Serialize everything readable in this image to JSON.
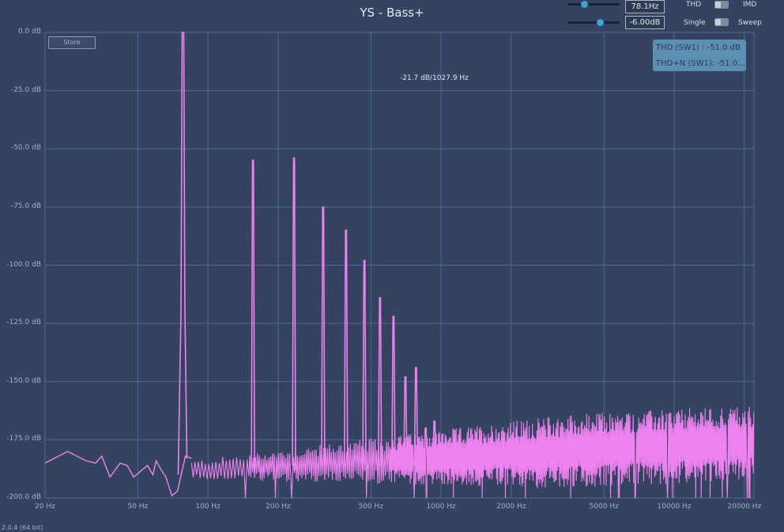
{
  "app": {
    "title": "YS - Bass+",
    "version": "2.0.4 (64 bit)",
    "store_label": "Store",
    "cursor_readout": "-21.7 dB/1027.9 Hz"
  },
  "controls": {
    "frequency": {
      "value": "78.1Hz",
      "level": 0.32
    },
    "amplitude": {
      "value": "-6.00dB",
      "level": 0.62
    },
    "mode_left": "THD",
    "mode_right": "IMD",
    "run_left": "Single",
    "run_right": "Sweep"
  },
  "thd_box": {
    "thd": "THD (SW1) : -51.0 dB",
    "thdn": "THD+N (SW1): -51.0..."
  },
  "colors": {
    "background": "#344460",
    "grid": "#4f6890",
    "trace": "#ee82ee",
    "accent": "#3aa3d8"
  },
  "chart_data": {
    "type": "line",
    "xscale": "log",
    "xlim": [
      20,
      22000
    ],
    "ylim": [
      -200,
      0
    ],
    "x_ticks": [
      {
        "value": 20,
        "label": "20 Hz"
      },
      {
        "value": 50,
        "label": "50 Hz"
      },
      {
        "value": 100,
        "label": "100 Hz"
      },
      {
        "value": 200,
        "label": "200 Hz"
      },
      {
        "value": 500,
        "label": "500 Hz"
      },
      {
        "value": 1000,
        "label": "1000 Hz"
      },
      {
        "value": 2000,
        "label": "2000 Hz"
      },
      {
        "value": 5000,
        "label": "5000 Hz"
      },
      {
        "value": 10000,
        "label": "10000 Hz"
      },
      {
        "value": 20000,
        "label": "20000 Hz"
      }
    ],
    "y_ticks": [
      {
        "value": 0,
        "label": "0.0 dB"
      },
      {
        "value": -25,
        "label": "-25.0 dB"
      },
      {
        "value": -50,
        "label": "-50.0 dB"
      },
      {
        "value": -75,
        "label": "-75.0 dB"
      },
      {
        "value": -100,
        "label": "-100.0 dB"
      },
      {
        "value": -125,
        "label": "-125.0 dB"
      },
      {
        "value": -150,
        "label": "-150.0 dB"
      },
      {
        "value": -175,
        "label": "-175.0 dB"
      },
      {
        "value": -200,
        "label": "-200.0 dB"
      }
    ],
    "fundamental": {
      "freq": 78.1,
      "level": 0
    },
    "harmonics": [
      {
        "freq": 156,
        "level": -55
      },
      {
        "freq": 234,
        "level": -54
      },
      {
        "freq": 312,
        "level": -75
      },
      {
        "freq": 391,
        "level": -85
      },
      {
        "freq": 469,
        "level": -98
      },
      {
        "freq": 547,
        "level": -114
      },
      {
        "freq": 625,
        "level": -122
      },
      {
        "freq": 703,
        "level": -148
      },
      {
        "freq": 781,
        "level": -144
      },
      {
        "freq": 859,
        "level": -170
      },
      {
        "freq": 937,
        "level": -167
      }
    ],
    "noise_floor": [
      [
        20,
        -185
      ],
      [
        25,
        -180
      ],
      [
        30,
        -184
      ],
      [
        33,
        -185
      ],
      [
        35,
        -182
      ],
      [
        38,
        -191
      ],
      [
        42,
        -185
      ],
      [
        45,
        -186
      ],
      [
        48,
        -191
      ],
      [
        52,
        -188
      ],
      [
        55,
        -186
      ],
      [
        58,
        -190
      ],
      [
        60,
        -184
      ],
      [
        63,
        -188
      ],
      [
        66,
        -191
      ],
      [
        70,
        -199
      ],
      [
        74,
        -197
      ],
      [
        80,
        -182
      ],
      [
        85,
        -183
      ]
    ]
  }
}
